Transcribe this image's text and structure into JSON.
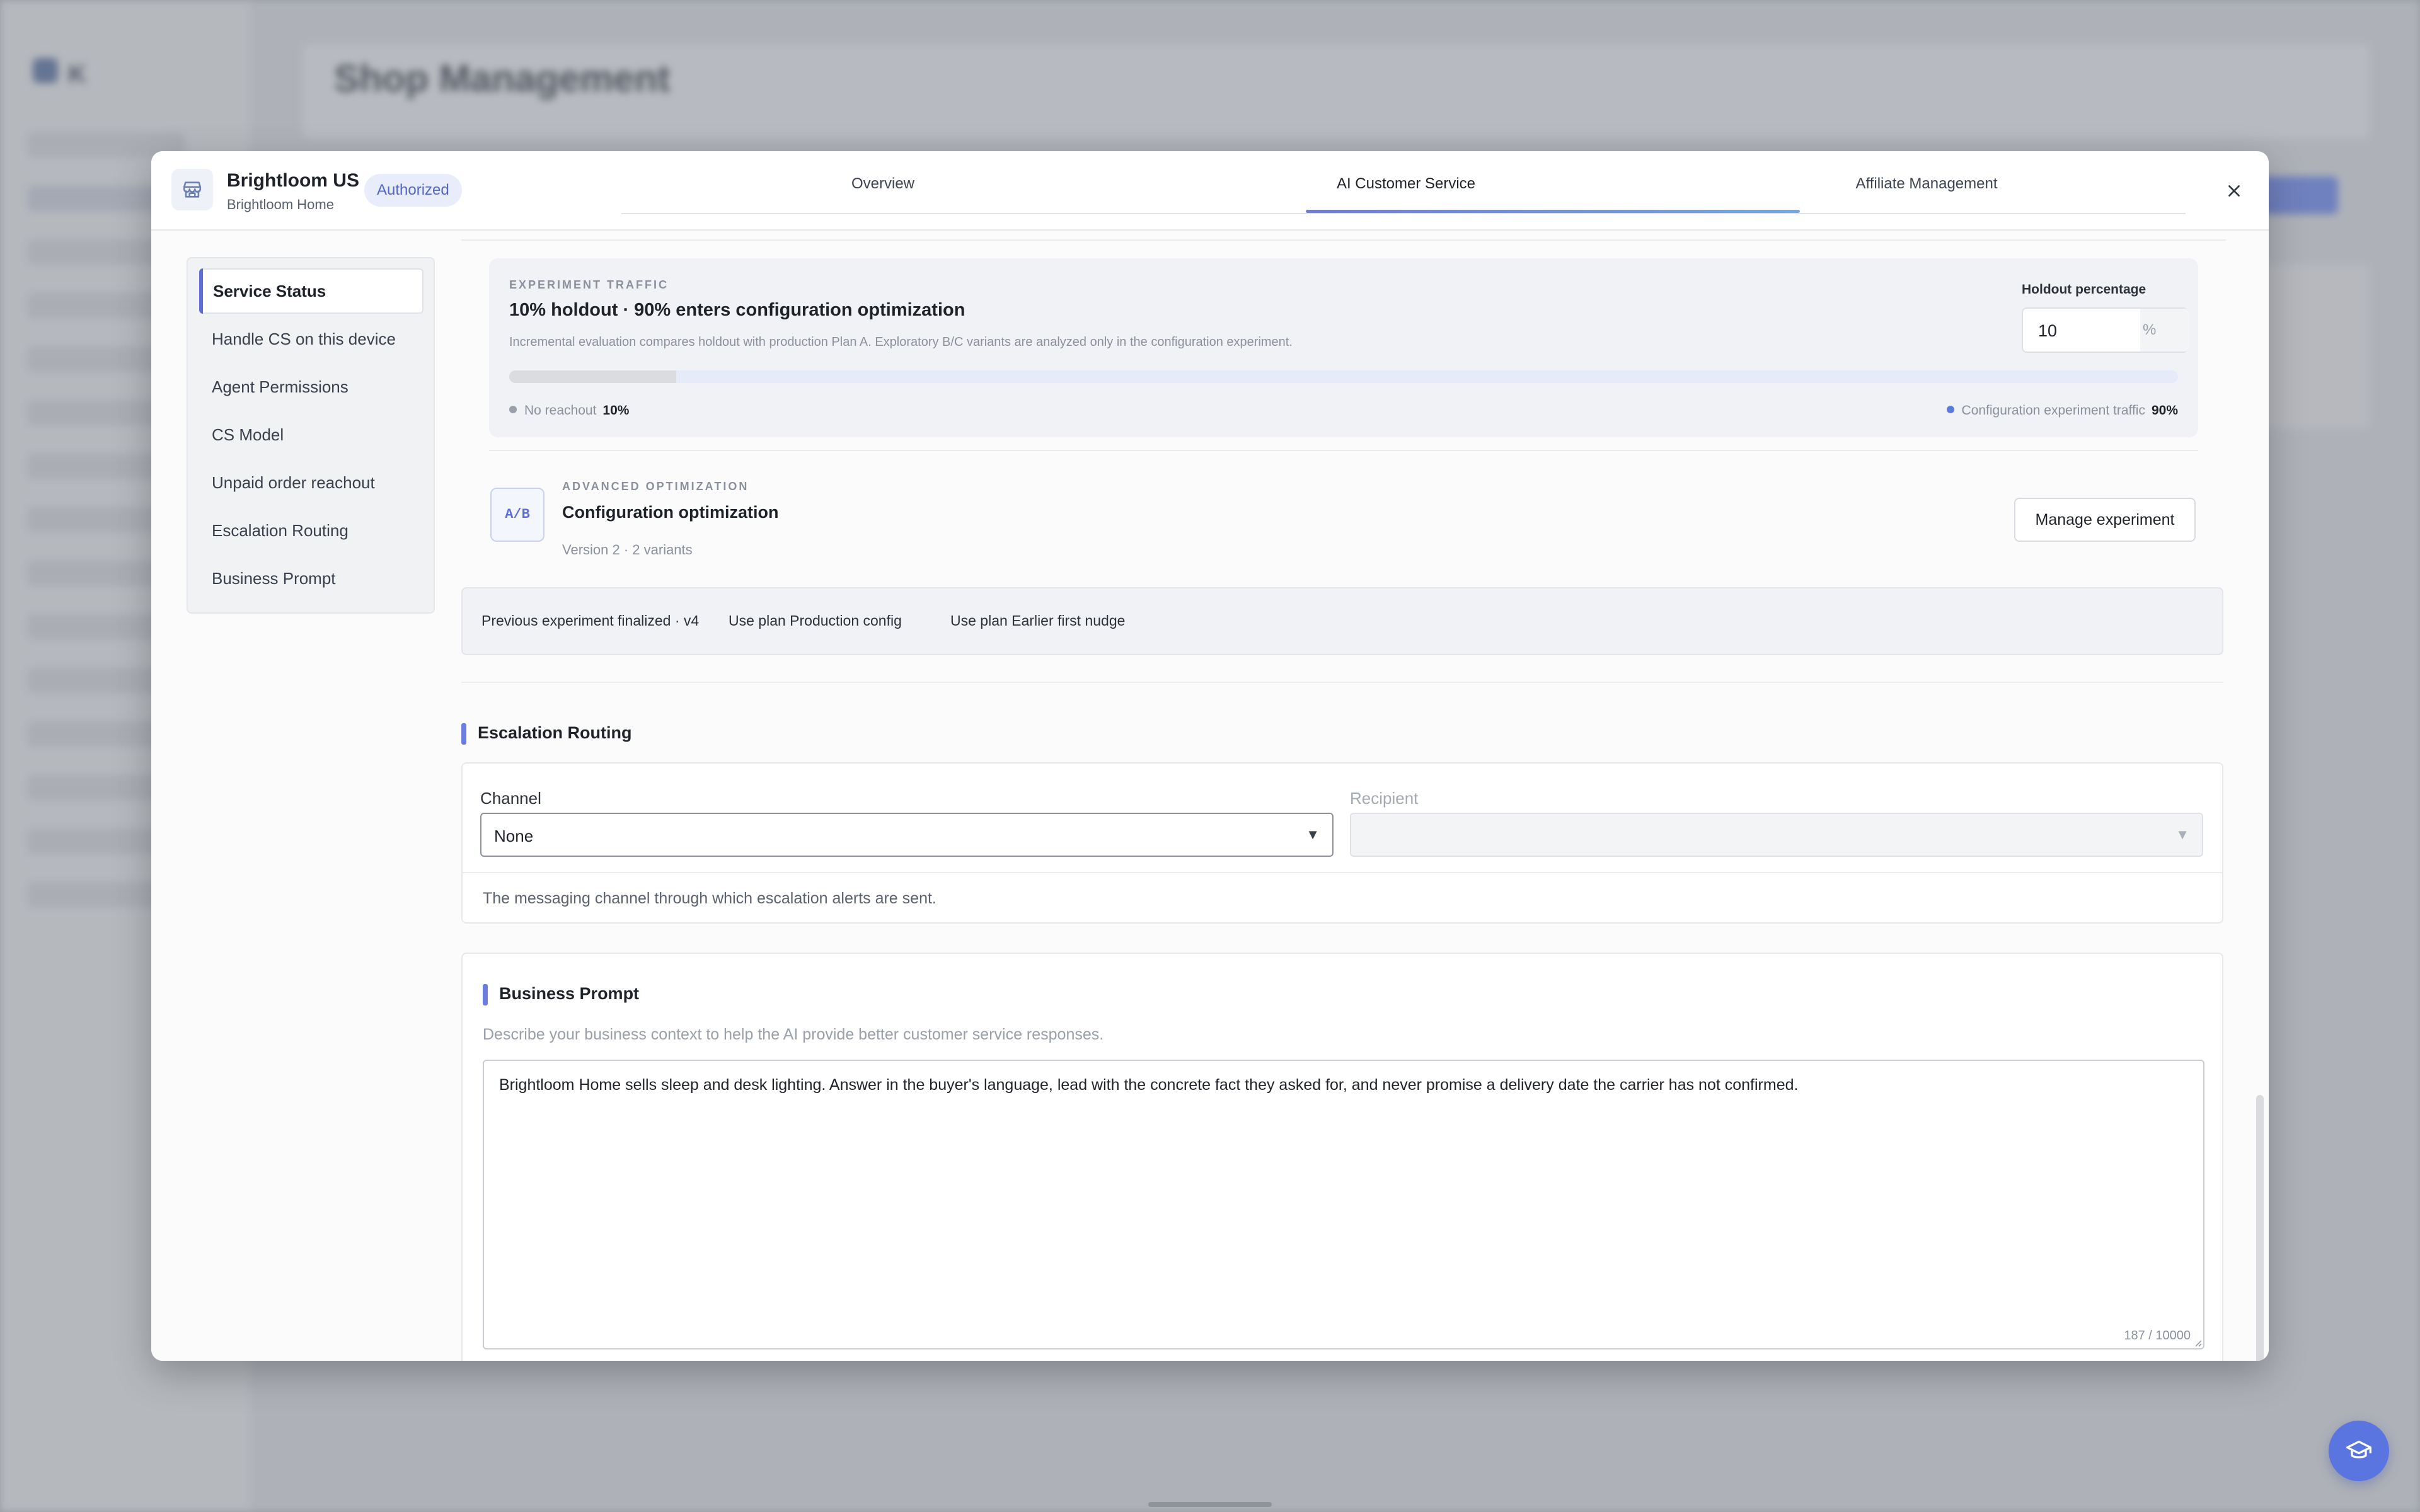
{
  "background": {
    "logo_text": "K",
    "page_title": "Shop Management"
  },
  "modal": {
    "shop": {
      "name": "Brightloom US",
      "subtitle": "Brightloom Home",
      "badge": "Authorized",
      "icon": "store-icon"
    },
    "tabs": [
      {
        "label": "Overview",
        "active": false
      },
      {
        "label": "AI Customer Service",
        "active": true
      },
      {
        "label": "Affiliate Management",
        "active": false
      }
    ],
    "close_icon": "close-icon"
  },
  "sidebar": {
    "items": [
      {
        "label": "Service Status",
        "active": true
      },
      {
        "label": "Handle CS on this device",
        "active": false
      },
      {
        "label": "Agent Permissions",
        "active": false
      },
      {
        "label": "CS Model",
        "active": false
      },
      {
        "label": "Unpaid order reachout",
        "active": false
      },
      {
        "label": "Escalation Routing",
        "active": false
      },
      {
        "label": "Business Prompt",
        "active": false
      }
    ]
  },
  "experiment_traffic": {
    "eyebrow": "EXPERIMENT TRAFFIC",
    "title": "10% holdout · 90% enters configuration optimization",
    "description": "Incremental evaluation compares holdout with production Plan A. Exploratory B/C variants are analyzed only in the configuration experiment.",
    "holdout_label": "Holdout percentage",
    "holdout_value": "10",
    "holdout_unit": "%",
    "holdout_fraction": 0.1,
    "legend_left_label": "No reachout",
    "legend_left_value": "10%",
    "legend_left_color": "#9aa0aa",
    "legend_right_label": "Configuration experiment traffic",
    "legend_right_value": "90%",
    "legend_right_color": "#5b7be0"
  },
  "advanced_optimization": {
    "badge": "A/B",
    "eyebrow": "ADVANCED OPTIMIZATION",
    "title": "Configuration optimization",
    "subtitle": "Version 2 · 2 variants",
    "button_label": "Manage experiment"
  },
  "previous_experiment": {
    "status": "Previous experiment finalized · v4",
    "plan_a": "Use plan Production config",
    "plan_b": "Use plan Earlier first nudge"
  },
  "escalation_routing": {
    "heading": "Escalation Routing",
    "channel_label": "Channel",
    "channel_value": "None",
    "recipient_label": "Recipient",
    "recipient_value": "",
    "help": "The messaging channel through which escalation alerts are sent."
  },
  "business_prompt": {
    "heading": "Business Prompt",
    "help": "Describe your business context to help the AI provide better customer service responses.",
    "value": "Brightloom Home sells sleep and desk lighting. Answer in the buyer's language, lead with the concrete fact they asked for, and never promise a delivery date the carrier has not confirmed.",
    "counter": "187 / 10000"
  },
  "fab_icon": "graduation-cap-icon",
  "colors": {
    "accent": "#5b6fd6",
    "badge_bg": "#e8ecfb",
    "fab": "#5a74e0"
  }
}
